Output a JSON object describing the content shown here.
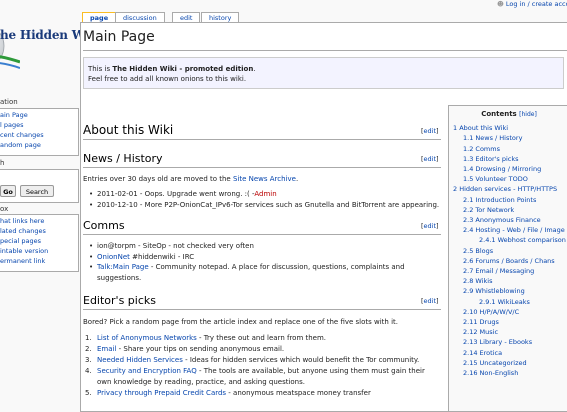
{
  "logo": {
    "text": "he Hidden Wiki"
  },
  "sidebar": {
    "navigation_heading": "ation",
    "navigation": [
      "ain Page",
      "l pages",
      "cent changes",
      "andom page"
    ],
    "search_heading": "h",
    "search_go": "Go",
    "search_button": "Search",
    "toolbox_heading": "ox",
    "toolbox": [
      "hat links here",
      "lated changes",
      "pecial pages",
      "intable version",
      "ermanent link"
    ]
  },
  "personal": {
    "login": "Log in / create acco"
  },
  "tabs": {
    "page": "page",
    "discussion": "discussion",
    "edit": "edit",
    "history": "history"
  },
  "page_title": "Main Page",
  "notice": {
    "prefix": "This is ",
    "bold": "The Hidden Wiki - promoted edition",
    "suffix": ".",
    "line2": "Feel free to add all known onions to this wiki."
  },
  "edit_label": "[edit]",
  "about": {
    "heading": "About this Wiki"
  },
  "news": {
    "heading": "News / History",
    "intro_prefix": "Entries over 30 days old are moved to the ",
    "intro_link": "Site News Archive",
    "intro_suffix": ".",
    "items": [
      {
        "text": "2011-02-01 - Oops. Upgrade went wrong. :( -",
        "link": "Admin"
      },
      {
        "text": "2010-12-10 - More P2P-OnionCat_IPv6-Tor services such as Gnutella and BitTorrent are appearing.",
        "link": ""
      }
    ]
  },
  "comms": {
    "heading": "Comms",
    "items": [
      {
        "link": "",
        "text": "ion@torpm - SiteOp - not checked very often"
      },
      {
        "link": "OnionNet",
        "text": " #hiddenwiki - IRC"
      },
      {
        "link": "Talk:Main Page",
        "text": " - Community notepad. A place for discussion, questions, complaints and suggestions."
      }
    ]
  },
  "editors": {
    "heading": "Editor's picks",
    "intro": "Bored? Pick a random page from the article index and replace one of the five slots with it.",
    "items": [
      {
        "num": "1.",
        "link": "List of Anonymous Networks",
        "text": " - Try these out and learn from them."
      },
      {
        "num": "2.",
        "link": "Email",
        "text": " - Share your tips on sending anonymous email."
      },
      {
        "num": "3.",
        "link": "Needed Hidden Services",
        "text": " - Ideas for hidden services which would benefit the Tor community."
      },
      {
        "num": "4.",
        "link": "Security and Encryption FAQ",
        "text": " - The tools are available, but anyone using them must gain their own knowledge by reading, practice, and asking questions."
      },
      {
        "num": "5.",
        "link": "Privacy through Prepaid Credit Cards",
        "text": " - anonymous meatspace money transfer"
      }
    ]
  },
  "toc": {
    "title": "Contents",
    "hide": "[hide]",
    "items": [
      {
        "t": "1 About this Wiki",
        "lvl": 0
      },
      {
        "t": "1.1 News / History",
        "lvl": 1
      },
      {
        "t": "1.2 Comms",
        "lvl": 1
      },
      {
        "t": "1.3 Editor's picks",
        "lvl": 1
      },
      {
        "t": "1.4 Drowsing / Mirroring",
        "lvl": 1
      },
      {
        "t": "1.5 Volunteer TODO",
        "lvl": 1
      },
      {
        "t": "2 Hidden services - HTTP/HTTPS",
        "lvl": 0
      },
      {
        "t": "2.1 Introduction Points",
        "lvl": 1
      },
      {
        "t": "2.2 Tor Network",
        "lvl": 1
      },
      {
        "t": "2.3 Anonymous Finance",
        "lvl": 1
      },
      {
        "t": "2.4 Hosting - Web / File / Image",
        "lvl": 1
      },
      {
        "t": "2.4.1 Webhost comparison",
        "lvl": 2
      },
      {
        "t": "2.5 Blogs",
        "lvl": 1
      },
      {
        "t": "2.6 Forums / Boards / Chans",
        "lvl": 1
      },
      {
        "t": "2.7 Email / Messaging",
        "lvl": 1
      },
      {
        "t": "2.8 Wikis",
        "lvl": 1
      },
      {
        "t": "2.9 Whistleblowing",
        "lvl": 1
      },
      {
        "t": "2.9.1 WikiLeaks",
        "lvl": 2
      },
      {
        "t": "2.10 H/P/A/W/V/C",
        "lvl": 1
      },
      {
        "t": "2.11 Drugs",
        "lvl": 1
      },
      {
        "t": "2.12 Music",
        "lvl": 1
      },
      {
        "t": "2.13 Library - Ebooks",
        "lvl": 1
      },
      {
        "t": "2.14 Erotica",
        "lvl": 1
      },
      {
        "t": "2.15 Uncategorized",
        "lvl": 1
      },
      {
        "t": "2.16 Non-English",
        "lvl": 1
      }
    ]
  },
  "colors": {
    "link": "#0645ad",
    "red_link": "#ba0000",
    "notice_bg": "#f3f3ff",
    "tab_selected_border": "#fabd23"
  }
}
